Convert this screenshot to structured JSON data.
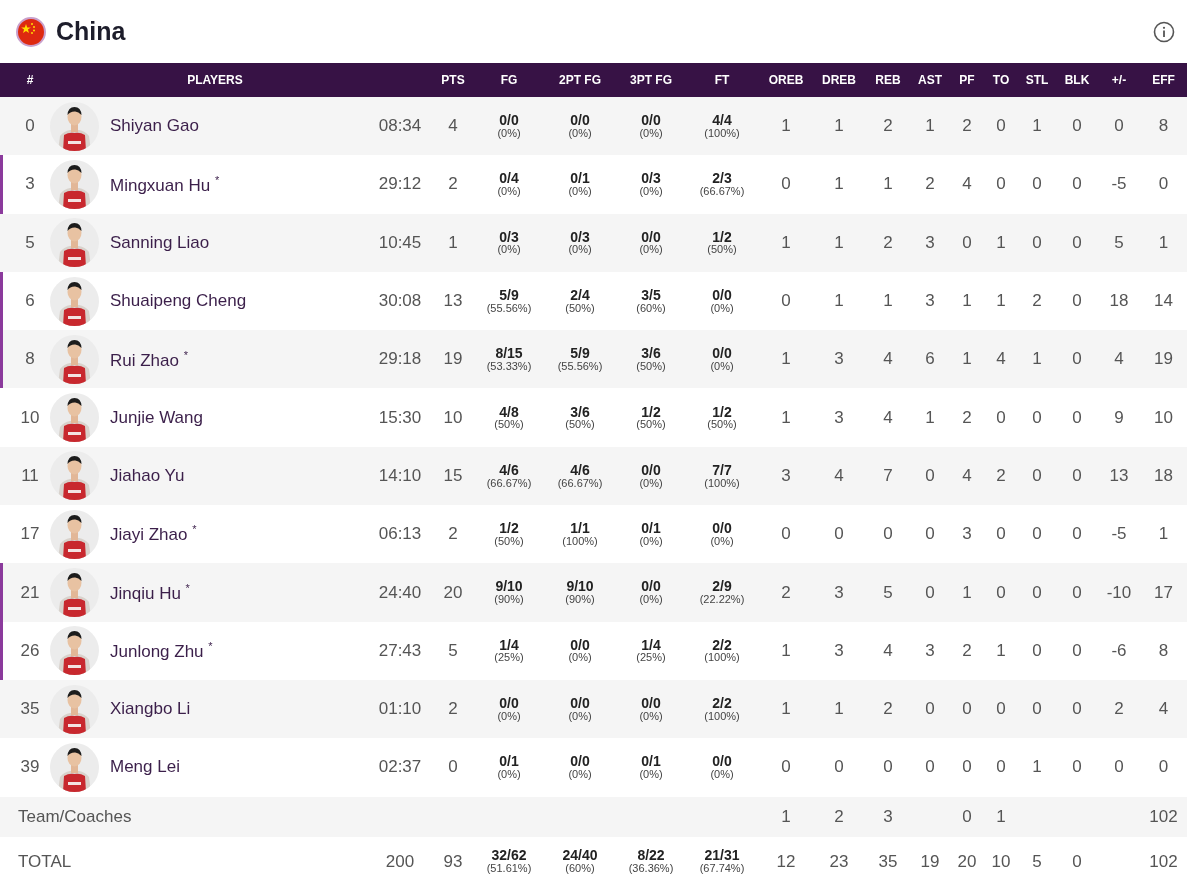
{
  "team": {
    "name": "China"
  },
  "columns": [
    "#",
    "PLAYERS",
    "PTS",
    "FG",
    "2PT FG",
    "3PT FG",
    "FT",
    "OREB",
    "DREB",
    "REB",
    "AST",
    "PF",
    "TO",
    "STL",
    "BLK",
    "+/-",
    "EFF"
  ],
  "players": [
    {
      "number": "0",
      "name": "Shiyan Gao",
      "starter": false,
      "min": "08:34",
      "pts": "4",
      "shots": [
        [
          "0/0",
          "(0%)"
        ],
        [
          "0/0",
          "(0%)"
        ],
        [
          "0/0",
          "(0%)"
        ],
        [
          "4/4",
          "(100%)"
        ]
      ],
      "stats": [
        "1",
        "1",
        "2",
        "1",
        "2",
        "0",
        "1",
        "0",
        "0",
        "8"
      ]
    },
    {
      "number": "3",
      "name": "Mingxuan Hu $^{*}$",
      "starter": true,
      "min": "29:12",
      "pts": "2",
      "shots": [
        [
          "0/4",
          "(0%)"
        ],
        [
          "0/1",
          "(0%)"
        ],
        [
          "0/3",
          "(0%)"
        ],
        [
          "2/3",
          "(66.67%)"
        ]
      ],
      "stats": [
        "0",
        "1",
        "1",
        "2",
        "4",
        "0",
        "0",
        "0",
        "-5",
        "0"
      ]
    },
    {
      "number": "5",
      "name": "Sanning Liao",
      "starter": false,
      "min": "10:45",
      "pts": "1",
      "shots": [
        [
          "0/3",
          "(0%)"
        ],
        [
          "0/3",
          "(0%)"
        ],
        [
          "0/0",
          "(0%)"
        ],
        [
          "1/2",
          "(50%)"
        ]
      ],
      "stats": [
        "1",
        "1",
        "2",
        "3",
        "0",
        "1",
        "0",
        "0",
        "5",
        "1"
      ]
    },
    {
      "number": "6",
      "name": "Shuaipeng Cheng",
      "starter": true,
      "min": "30:08",
      "pts": "13",
      "shots": [
        [
          "5/9",
          "(55.56%)"
        ],
        [
          "2/4",
          "(50%)"
        ],
        [
          "3/5",
          "(60%)"
        ],
        [
          "0/0",
          "(0%)"
        ]
      ],
      "stats": [
        "0",
        "1",
        "1",
        "3",
        "1",
        "1",
        "2",
        "0",
        "18",
        "14"
      ]
    },
    {
      "number": "8",
      "name": "Rui Zhao $^{*}$",
      "starter": true,
      "min": "29:18",
      "pts": "19",
      "shots": [
        [
          "8/15",
          "(53.33%)"
        ],
        [
          "5/9",
          "(55.56%)"
        ],
        [
          "3/6",
          "(50%)"
        ],
        [
          "0/0",
          "(0%)"
        ]
      ],
      "stats": [
        "1",
        "3",
        "4",
        "6",
        "1",
        "4",
        "1",
        "0",
        "4",
        "19"
      ]
    },
    {
      "number": "10",
      "name": "Junjie Wang",
      "starter": false,
      "min": "15:30",
      "pts": "10",
      "shots": [
        [
          "4/8",
          "(50%)"
        ],
        [
          "3/6",
          "(50%)"
        ],
        [
          "1/2",
          "(50%)"
        ],
        [
          "1/2",
          "(50%)"
        ]
      ],
      "stats": [
        "1",
        "3",
        "4",
        "1",
        "2",
        "0",
        "0",
        "0",
        "9",
        "10"
      ]
    },
    {
      "number": "11",
      "name": "Jiahao Yu",
      "starter": false,
      "min": "14:10",
      "pts": "15",
      "shots": [
        [
          "4/6",
          "(66.67%)"
        ],
        [
          "4/6",
          "(66.67%)"
        ],
        [
          "0/0",
          "(0%)"
        ],
        [
          "7/7",
          "(100%)"
        ]
      ],
      "stats": [
        "3",
        "4",
        "7",
        "0",
        "4",
        "2",
        "0",
        "0",
        "13",
        "18"
      ]
    },
    {
      "number": "17",
      "name": "Jiayi Zhao $^{*}$",
      "starter": false,
      "min": "06:13",
      "pts": "2",
      "shots": [
        [
          "1/2",
          "(50%)"
        ],
        [
          "1/1",
          "(100%)"
        ],
        [
          "0/1",
          "(0%)"
        ],
        [
          "0/0",
          "(0%)"
        ]
      ],
      "stats": [
        "0",
        "0",
        "0",
        "0",
        "3",
        "0",
        "0",
        "0",
        "-5",
        "1"
      ]
    },
    {
      "number": "21",
      "name": "Jinqiu Hu $^{*}$",
      "starter": true,
      "min": "24:40",
      "pts": "20",
      "shots": [
        [
          "9/10",
          "(90%)"
        ],
        [
          "9/10",
          "(90%)"
        ],
        [
          "0/0",
          "(0%)"
        ],
        [
          "2/9",
          "(22.22%)"
        ]
      ],
      "stats": [
        "2",
        "3",
        "5",
        "0",
        "1",
        "0",
        "0",
        "0",
        "-10",
        "17"
      ]
    },
    {
      "number": "26",
      "name": "Junlong Zhu $^{*}$",
      "starter": true,
      "min": "27:43",
      "pts": "5",
      "shots": [
        [
          "1/4",
          "(25%)"
        ],
        [
          "0/0",
          "(0%)"
        ],
        [
          "1/4",
          "(25%)"
        ],
        [
          "2/2",
          "(100%)"
        ]
      ],
      "stats": [
        "1",
        "3",
        "4",
        "3",
        "2",
        "1",
        "0",
        "0",
        "-6",
        "8"
      ]
    },
    {
      "number": "35",
      "name": "Xiangbo Li",
      "starter": false,
      "min": "01:10",
      "pts": "2",
      "shots": [
        [
          "0/0",
          "(0%)"
        ],
        [
          "0/0",
          "(0%)"
        ],
        [
          "0/0",
          "(0%)"
        ],
        [
          "2/2",
          "(100%)"
        ]
      ],
      "stats": [
        "1",
        "1",
        "2",
        "0",
        "0",
        "0",
        "0",
        "0",
        "2",
        "4"
      ]
    },
    {
      "number": "39",
      "name": "Meng Lei",
      "starter": false,
      "min": "02:37",
      "pts": "0",
      "shots": [
        [
          "0/1",
          "(0%)"
        ],
        [
          "0/0",
          "(0%)"
        ],
        [
          "0/1",
          "(0%)"
        ],
        [
          "0/0",
          "(0%)"
        ]
      ],
      "stats": [
        "0",
        "0",
        "0",
        "0",
        "0",
        "0",
        "1",
        "0",
        "0",
        "0"
      ]
    }
  ],
  "team_coaches": {
    "label": "Team/Coaches",
    "oreb": "1",
    "dreb": "2",
    "reb": "3",
    "pf": "0",
    "to": "1",
    "eff": "102"
  },
  "total": {
    "label": "TOTAL",
    "min": "200",
    "pts": "93",
    "shots": [
      [
        "32/62",
        "(51.61%)"
      ],
      [
        "24/40",
        "(60%)"
      ],
      [
        "8/22",
        "(36.36%)"
      ],
      [
        "21/31",
        "(67.74%)"
      ]
    ],
    "stats": [
      "12",
      "23",
      "35",
      "19",
      "20",
      "10",
      "5",
      "0"
    ],
    "eff": "102"
  }
}
